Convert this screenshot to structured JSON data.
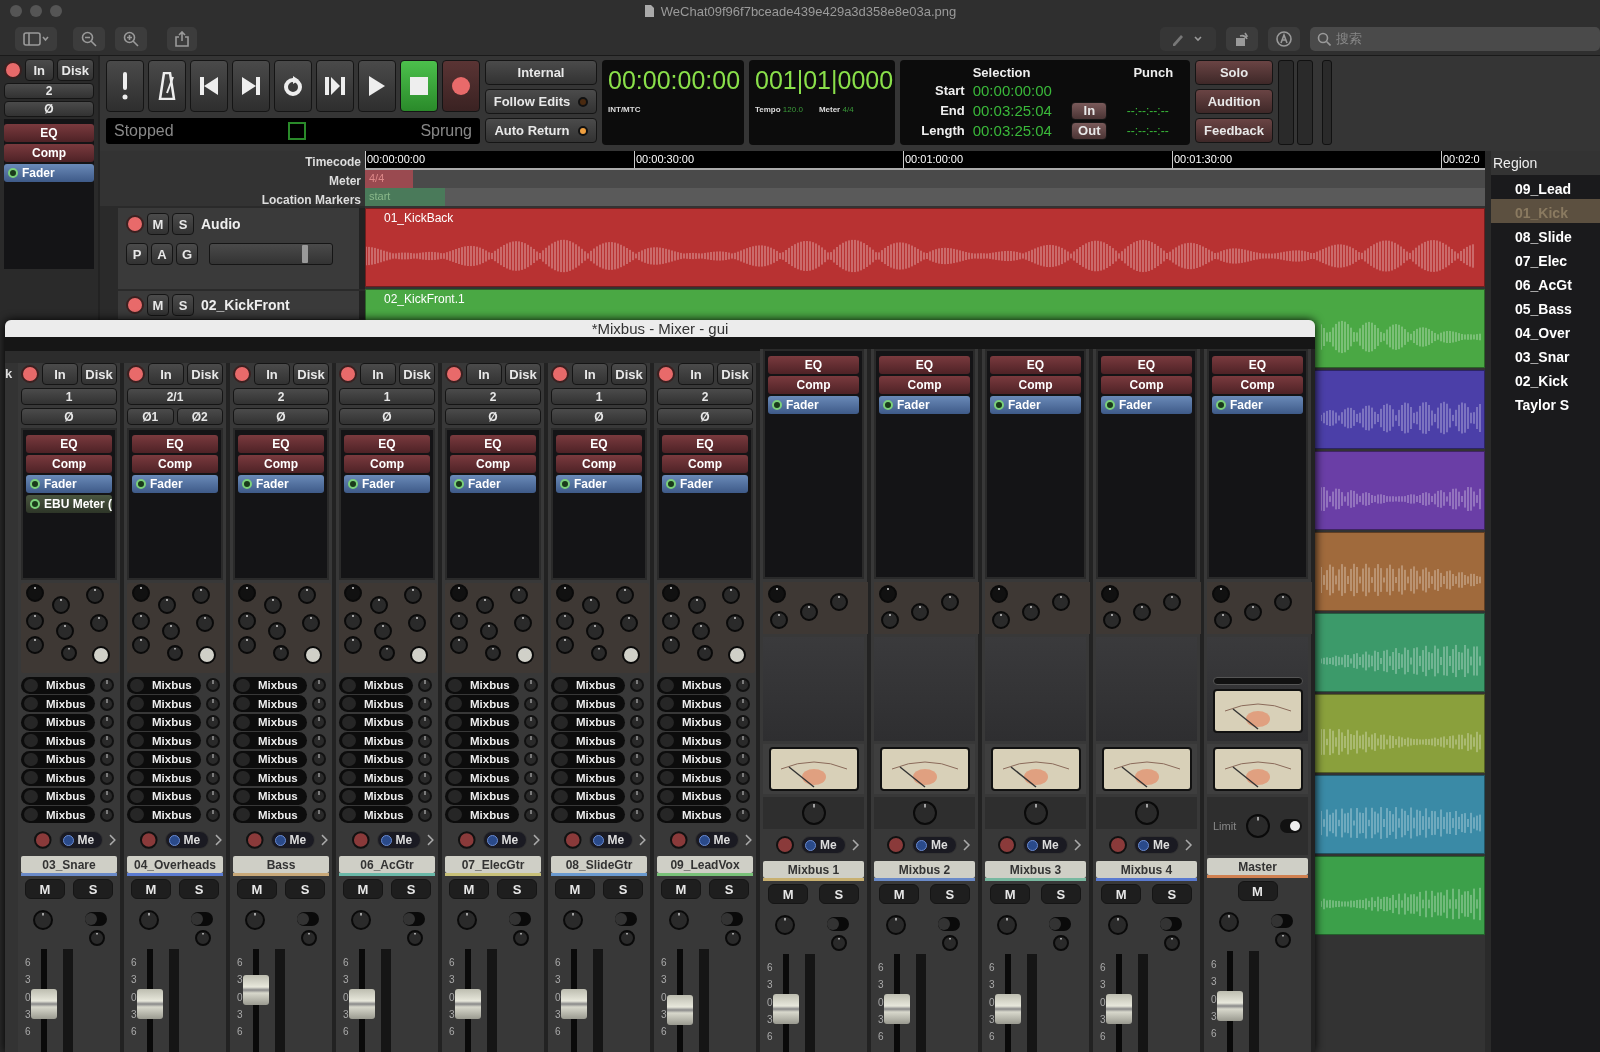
{
  "window": {
    "title": "WeChat09f96f7bceade439e429a3d358e8e03a.png",
    "search": {
      "placeholder": "搜索"
    }
  },
  "monitor_section": {
    "input_buttons": [
      "In",
      "Disk"
    ],
    "input": "2",
    "phase": [
      "Ø"
    ],
    "plugins": [
      {
        "name": "EQ",
        "kind": "builtin"
      },
      {
        "name": "Comp",
        "kind": "builtin"
      },
      {
        "name": "Fader",
        "kind": "fader"
      }
    ]
  },
  "transport": {
    "buttons": [
      {
        "kind": "panic",
        "active": false
      },
      {
        "kind": "metronome",
        "active": false
      },
      {
        "kind": "start",
        "active": false
      },
      {
        "kind": "end",
        "active": false
      },
      {
        "kind": "loop",
        "active": false
      },
      {
        "kind": "range",
        "active": false
      },
      {
        "kind": "play",
        "active": false
      },
      {
        "kind": "stop",
        "active": true
      },
      {
        "kind": "record",
        "active": false
      }
    ],
    "status": "Stopped",
    "mode": "Sprung"
  },
  "sync": {
    "source": "Internal",
    "options": [
      {
        "label": "Follow Edits",
        "on": false
      },
      {
        "label": "Auto Return",
        "on": true
      }
    ]
  },
  "clocks": [
    {
      "time": "00:00:00:00",
      "info": [
        {
          "label": "INT/MTC"
        }
      ]
    },
    {
      "time": "001|01|0000",
      "info": [
        {
          "label": "Tempo",
          "value": "120.0"
        },
        {
          "label": "Meter",
          "value": "4/4"
        }
      ]
    }
  ],
  "selection": {
    "title": "Selection",
    "rows": [
      {
        "label": "Start",
        "value": "00:00:00:00"
      },
      {
        "label": "End",
        "value": "00:03:25:04"
      },
      {
        "label": "Length",
        "value": "00:03:25:04"
      }
    ]
  },
  "punch": {
    "title": "Punch",
    "rows": [
      {
        "label": "In",
        "value": "--:--:--:--"
      },
      {
        "label": "Out",
        "value": "--:--:--:--"
      }
    ]
  },
  "monitor_buttons": [
    "Solo",
    "Audition",
    "Feedback"
  ],
  "rulers": {
    "labels": [
      "Timecode",
      "Meter",
      "Location Markers"
    ],
    "ticks": [
      "00:00:00:00",
      "00:00:30:00",
      "00:01:00:00",
      "00:01:30:00",
      "00:02:0"
    ],
    "meter_marker": "4/4",
    "location_marker": "start"
  },
  "tracks": [
    {
      "name": "Audio",
      "buttons": [
        "M",
        "S"
      ],
      "automation_buttons": [
        "P",
        "A",
        "G"
      ],
      "level": 0.78
    },
    {
      "name": "02_KickFront",
      "buttons": [
        "M",
        "S"
      ]
    }
  ],
  "regions": [
    {
      "name": "01_KickBack",
      "color": "#b83232"
    },
    {
      "name": "02_KickFront.1",
      "color": "#4aa844"
    },
    {
      "color": "#4b3fa8"
    },
    {
      "color": "#6a3ea6"
    },
    {
      "color": "#a06a3c"
    },
    {
      "color": "#3c9a6a"
    },
    {
      "color": "#8aa03c"
    },
    {
      "color": "#3a8aa6"
    },
    {
      "color": "#3ca04a"
    }
  ],
  "region_list": {
    "title": "Region",
    "items": [
      {
        "name": "09_Lead",
        "selected": false
      },
      {
        "name": "01_Kick",
        "selected": true
      },
      {
        "name": "08_Slide",
        "selected": false
      },
      {
        "name": "07_Elec",
        "selected": false
      },
      {
        "name": "06_AcGt",
        "selected": false
      },
      {
        "name": "05_Bass",
        "selected": false
      },
      {
        "name": "04_Over",
        "selected": false
      },
      {
        "name": "03_Snar",
        "selected": false
      },
      {
        "name": "02_Kick",
        "selected": false
      },
      {
        "name": "Taylor S",
        "selected": false
      }
    ]
  },
  "mixer": {
    "title": "*Mixbus - Mixer - gui",
    "partial_strip": {
      "text": "k"
    },
    "strips": [
      {
        "kind": "track",
        "name": "03_Snare",
        "color": "#6a8ac8",
        "input_buttons": [
          "In",
          "Disk"
        ],
        "input": "1",
        "phase": [
          "Ø"
        ],
        "plugins": [
          {
            "name": "EQ",
            "kind": "builtin"
          },
          {
            "name": "Comp",
            "kind": "builtin"
          },
          {
            "name": "Fader",
            "kind": "fader"
          },
          {
            "name": "EBU Meter (",
            "kind": "plugin"
          }
        ],
        "sends": [
          "Mixbus",
          "Mixbus",
          "Mixbus",
          "Mixbus",
          "Mixbus",
          "Mixbus",
          "Mixbus",
          "Mixbus"
        ],
        "monitor": "Me",
        "mute": "M",
        "solo": "S",
        "scale": [
          "6",
          "3",
          "0",
          "3",
          "6"
        ],
        "level": 0.5
      },
      {
        "kind": "track",
        "name": "04_Overheads",
        "color": "#5a7ad0",
        "input_buttons": [
          "In",
          "Disk"
        ],
        "input": "2/1",
        "phase": [
          "Ø1",
          "Ø2"
        ],
        "plugins": [
          {
            "name": "EQ",
            "kind": "builtin"
          },
          {
            "name": "Comp",
            "kind": "builtin"
          },
          {
            "name": "Fader",
            "kind": "fader"
          }
        ],
        "sends": [
          "Mixbus",
          "Mixbus",
          "Mixbus",
          "Mixbus",
          "Mixbus",
          "Mixbus",
          "Mixbus",
          "Mixbus"
        ],
        "monitor": "Me",
        "mute": "M",
        "solo": "S",
        "scale": [
          "6",
          "3",
          "0",
          "3",
          "6"
        ],
        "level": 0.5
      },
      {
        "kind": "track",
        "name": "Bass",
        "color": "#c8a878",
        "input_buttons": [
          "In",
          "Disk"
        ],
        "input": "2",
        "phase": [
          "Ø"
        ],
        "plugins": [
          {
            "name": "EQ",
            "kind": "builtin"
          },
          {
            "name": "Comp",
            "kind": "builtin"
          },
          {
            "name": "Fader",
            "kind": "fader"
          }
        ],
        "sends": [
          "Mixbus",
          "Mixbus",
          "Mixbus",
          "Mixbus",
          "Mixbus",
          "Mixbus",
          "Mixbus",
          "Mixbus"
        ],
        "monitor": "Me",
        "mute": "M",
        "solo": "S",
        "scale": [
          "6",
          "3",
          "0",
          "3",
          "6"
        ],
        "level": 0.68
      },
      {
        "kind": "track",
        "name": "06_AcGtr",
        "color": "#6ab8a8",
        "input_buttons": [
          "In",
          "Disk"
        ],
        "input": "1",
        "phase": [
          "Ø"
        ],
        "plugins": [
          {
            "name": "EQ",
            "kind": "builtin"
          },
          {
            "name": "Comp",
            "kind": "builtin"
          },
          {
            "name": "Fader",
            "kind": "fader"
          }
        ],
        "sends": [
          "Mixbus",
          "Mixbus",
          "Mixbus",
          "Mixbus",
          "Mixbus",
          "Mixbus",
          "Mixbus",
          "Mixbus"
        ],
        "monitor": "Me",
        "mute": "M",
        "solo": "S",
        "scale": [
          "6",
          "3",
          "0",
          "3",
          "6"
        ],
        "level": 0.5
      },
      {
        "kind": "track",
        "name": "07_ElecGtr",
        "color": "#c8c078",
        "input_buttons": [
          "In",
          "Disk"
        ],
        "input": "2",
        "phase": [
          "Ø"
        ],
        "plugins": [
          {
            "name": "EQ",
            "kind": "builtin"
          },
          {
            "name": "Comp",
            "kind": "builtin"
          },
          {
            "name": "Fader",
            "kind": "fader"
          }
        ],
        "sends": [
          "Mixbus",
          "Mixbus",
          "Mixbus",
          "Mixbus",
          "Mixbus",
          "Mixbus",
          "Mixbus",
          "Mixbus"
        ],
        "monitor": "Me",
        "mute": "M",
        "solo": "S",
        "scale": [
          "6",
          "3",
          "0",
          "3",
          "6"
        ],
        "level": 0.5
      },
      {
        "kind": "track",
        "name": "08_SlideGtr",
        "color": "#6a9ad0",
        "input_buttons": [
          "In",
          "Disk"
        ],
        "input": "1",
        "phase": [
          "Ø"
        ],
        "plugins": [
          {
            "name": "EQ",
            "kind": "builtin"
          },
          {
            "name": "Comp",
            "kind": "builtin"
          },
          {
            "name": "Fader",
            "kind": "fader"
          }
        ],
        "sends": [
          "Mixbus",
          "Mixbus",
          "Mixbus",
          "Mixbus",
          "Mixbus",
          "Mixbus",
          "Mixbus",
          "Mixbus"
        ],
        "monitor": "Me",
        "mute": "M",
        "solo": "S",
        "scale": [
          "6",
          "3",
          "0",
          "3",
          "6"
        ],
        "level": 0.5
      },
      {
        "kind": "track",
        "name": "09_LeadVox",
        "color": "#78c078",
        "input_buttons": [
          "In",
          "Disk"
        ],
        "input": "2",
        "phase": [
          "Ø"
        ],
        "plugins": [
          {
            "name": "EQ",
            "kind": "builtin"
          },
          {
            "name": "Comp",
            "kind": "builtin"
          },
          {
            "name": "Fader",
            "kind": "fader"
          }
        ],
        "sends": [
          "Mixbus",
          "Mixbus",
          "Mixbus",
          "Mixbus",
          "Mixbus",
          "Mixbus",
          "Mixbus",
          "Mixbus"
        ],
        "monitor": "Me",
        "mute": "M",
        "solo": "S",
        "scale": [
          "6",
          "3",
          "0",
          "3",
          "6"
        ],
        "level": 0.42
      },
      {
        "kind": "bus",
        "name": "Mixbus 1",
        "color": "#c8b070",
        "plugins": [
          {
            "name": "EQ",
            "kind": "builtin"
          },
          {
            "name": "Comp",
            "kind": "builtin"
          },
          {
            "name": "Fader",
            "kind": "fader"
          }
        ],
        "monitor": "Me",
        "mute": "M",
        "solo": "S",
        "scale": [
          "6",
          "3",
          "0",
          "3",
          "6"
        ],
        "level": 0.5
      },
      {
        "kind": "bus",
        "name": "Mixbus 2",
        "color": "#6a8ac8",
        "plugins": [
          {
            "name": "EQ",
            "kind": "builtin"
          },
          {
            "name": "Comp",
            "kind": "builtin"
          },
          {
            "name": "Fader",
            "kind": "fader"
          }
        ],
        "monitor": "Me",
        "mute": "M",
        "solo": "S",
        "scale": [
          "6",
          "3",
          "0",
          "3",
          "6"
        ],
        "level": 0.5
      },
      {
        "kind": "bus",
        "name": "Mixbus 3",
        "color": "#78b8a0",
        "plugins": [
          {
            "name": "EQ",
            "kind": "builtin"
          },
          {
            "name": "Comp",
            "kind": "builtin"
          },
          {
            "name": "Fader",
            "kind": "fader"
          }
        ],
        "monitor": "Me",
        "mute": "M",
        "solo": "S",
        "scale": [
          "6",
          "3",
          "0",
          "3",
          "6"
        ],
        "level": 0.5
      },
      {
        "kind": "bus",
        "name": "Mixbus 4",
        "color": "#5a7ad0",
        "plugins": [
          {
            "name": "EQ",
            "kind": "builtin"
          },
          {
            "name": "Comp",
            "kind": "builtin"
          },
          {
            "name": "Fader",
            "kind": "fader"
          }
        ],
        "monitor": "Me",
        "mute": "M",
        "solo": "S",
        "scale": [
          "6",
          "3",
          "0",
          "3",
          "6"
        ],
        "level": 0.5
      },
      {
        "kind": "master",
        "name": "Master",
        "color": "#d08050",
        "plugins": [
          {
            "name": "EQ",
            "kind": "builtin"
          },
          {
            "name": "Comp",
            "kind": "builtin"
          },
          {
            "name": "Fader",
            "kind": "fader"
          }
        ],
        "limiter": {
          "label": "Limit",
          "on": true
        },
        "mute": "M",
        "scale": [
          "6",
          "3",
          "0",
          "3",
          "6"
        ],
        "level": 0.5
      }
    ]
  }
}
